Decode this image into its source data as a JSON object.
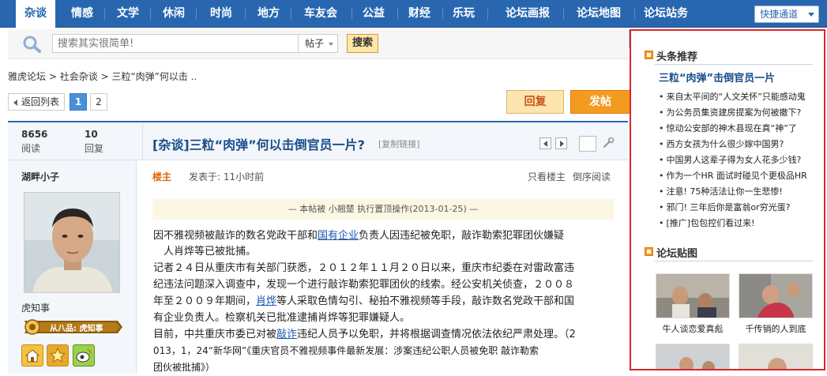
{
  "nav": {
    "items": [
      "杂谈",
      "情感",
      "文学",
      "休闲",
      "时尚",
      "地方",
      "车友会",
      "公益",
      "财经",
      "乐玩",
      "论坛画报",
      "论坛地图",
      "论坛站务"
    ],
    "active_index": 0,
    "quick_access": "快捷通道"
  },
  "search": {
    "placeholder": "搜索其实很简单!",
    "type": "帖子",
    "button": "搜索"
  },
  "breadcrumb": [
    "雅虎论坛",
    "社会杂谈",
    "三粒“肉弹”何以击 .."
  ],
  "pager": {
    "back": "返回列表",
    "pages": [
      "1",
      "2"
    ],
    "current": "1"
  },
  "actions": {
    "reply": "回复",
    "post": "发帖"
  },
  "thread": {
    "views": "8656",
    "views_label": "阅读",
    "replies": "10",
    "replies_label": "回复",
    "title": "[杂谈]三粒“肉弹”何以击倒官员一片?",
    "copy_link": "[复制链接]"
  },
  "author": {
    "name": "湖畔小子",
    "title": "虎知事",
    "rank": "从八品: 虎知事"
  },
  "post": {
    "floor": "楼主",
    "time": "发表于: 11小时前",
    "only_author": "只看楼主",
    "reverse": "倒序阅读",
    "notice": "— 本帖被 小翘楚 执行置顶操作(2013-01-25) —",
    "p1_a": "因不雅视频被敲诈的数名党政干部和",
    "p1_link": "国有企业",
    "p1_b": "负责人因违纪被免职，敲诈勒索犯罪团伙嫌疑",
    "p1_c": "人肖烨等已被批捕。",
    "p2_a": "记者２４日从重庆市有关部门获悉，２０１２年１１月２０日以来，重庆市纪委在对雷政富违",
    "p2_b": "纪违法问题深入调查中，发现一个进行敲诈勒索犯罪团伙的线索。经公安机关侦查，２００８",
    "p2_c": "年至２００９年期间，",
    "p2_link": "肖烨",
    "p2_d": "等人采取色情勾引、秘拍不雅视频等手段，敲诈数名党政干部和国",
    "p2_e": "有企业负责人。检察机关已批准逮捕肖烨等犯罪嫌疑人。",
    "p3_a": "目前，中共重庆市委已对被",
    "p3_link": "敲诈",
    "p3_b": "违纪人员予以免职，并将根据调查情况依法依纪严肃处理。（2",
    "p3_c": "013，1，24“新华网”《重庆官员不雅视频事件最新发展：涉案违纪公职人员被免职 敲诈勒索",
    "p3_d": "团伙被批捕》）"
  },
  "sidebar": {
    "headlines_title": "头条推荐",
    "headline": "三粒“肉弹”击倒官员一片",
    "news": [
      "来自太平间的“人文关怀”只能感动鬼",
      "为公务员集资建房提案为何被撤下?",
      "惊动公安部的神木县现在真“神”了",
      "西方女孩为什么很少嫁中国男?",
      "中国男人这辈子得为女人花多少钱?",
      "作为一个HR 面试时碰见个更极品HR",
      "注意! 75种活法让你一生悲惨!",
      "邪门! 三年后你是富翁or穷光蛋?",
      "[推广]包包控们看过来!"
    ],
    "pics_title": "论坛贴图",
    "pics": [
      "牛人谈恋爱真彪",
      "千传销的人到底"
    ]
  },
  "colors": {
    "nav_bg": "#2867b0",
    "accent_orange": "#f39a21",
    "sidebar_border": "#d9262c"
  }
}
